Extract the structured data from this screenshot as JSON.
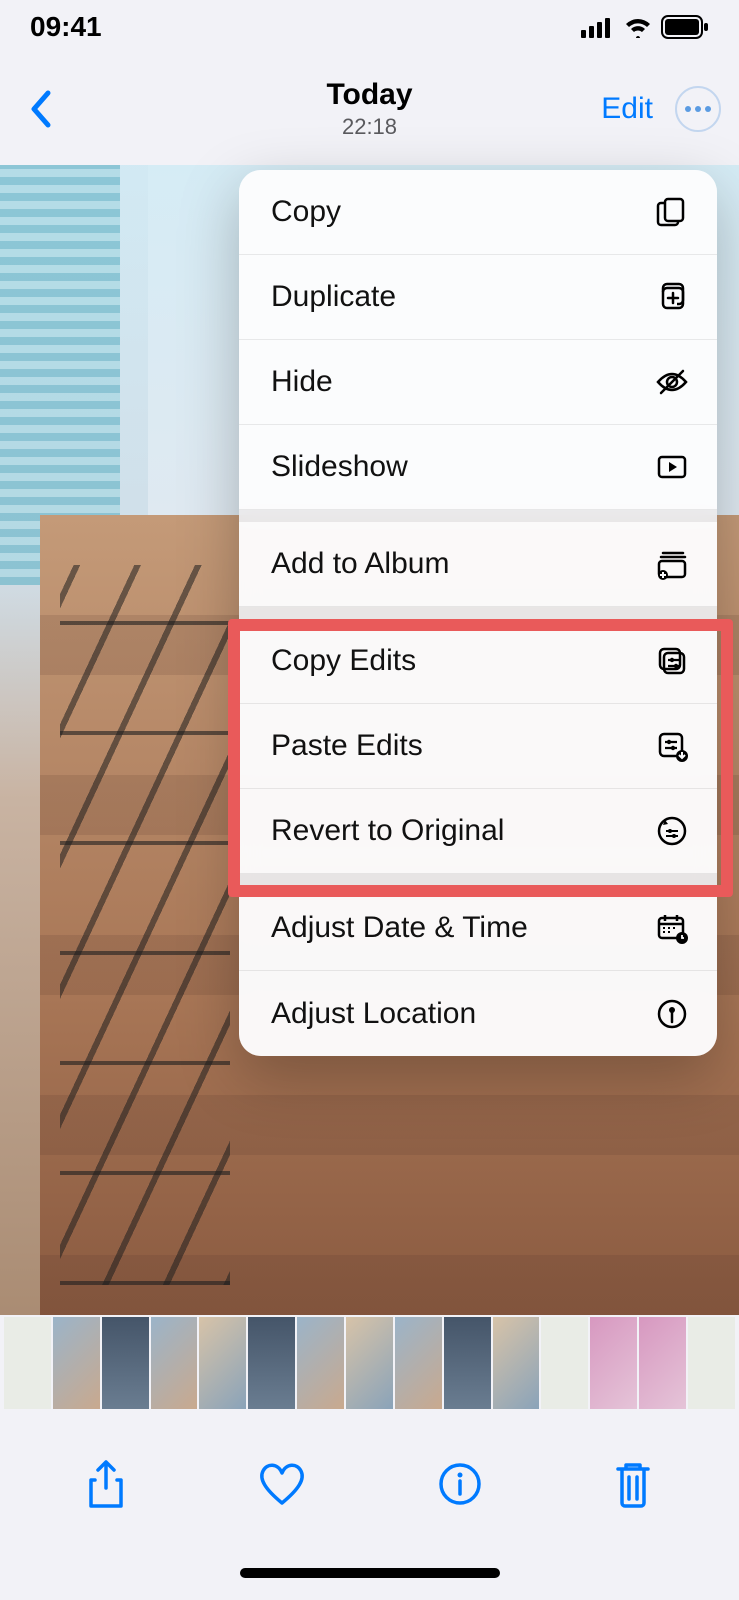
{
  "status": {
    "time": "09:41"
  },
  "nav": {
    "title": "Today",
    "subtitle": "22:18",
    "edit": "Edit"
  },
  "menu": {
    "copy": "Copy",
    "duplicate": "Duplicate",
    "hide": "Hide",
    "slideshow": "Slideshow",
    "addToAlbum": "Add to Album",
    "copyEdits": "Copy Edits",
    "pasteEdits": "Paste Edits",
    "revert": "Revert to Original",
    "adjustDate": "Adjust Date & Time",
    "adjustLoc": "Adjust Location"
  }
}
